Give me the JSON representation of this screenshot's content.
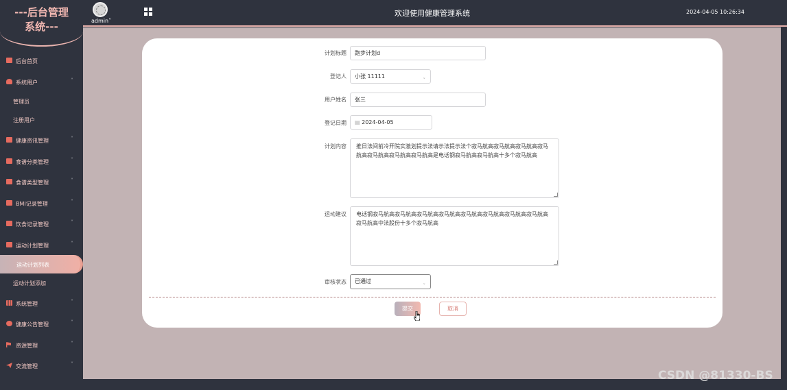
{
  "header": {
    "logo": "---后台管理系统---",
    "logo_line1": "---后台管理",
    "logo_line2": "系统---",
    "user": "admin",
    "title": "欢迎使用健康管理系统",
    "datetime": "2024-04-05 10:26:34"
  },
  "sidebar": {
    "items": [
      {
        "label": "后台首页",
        "icon": "monitor-icon"
      },
      {
        "label": "系统用户",
        "icon": "user-icon",
        "expanded": true
      },
      {
        "label": "管理员"
      },
      {
        "label": "注册用户"
      },
      {
        "label": "健康资讯管理",
        "icon": "chart-icon"
      },
      {
        "label": "食谱分类管理",
        "icon": "chart-icon"
      },
      {
        "label": "食谱类型管理",
        "icon": "chart-icon"
      },
      {
        "label": "BMI记录管理",
        "icon": "chart-icon"
      },
      {
        "label": "饮食记录管理",
        "icon": "chart-icon"
      },
      {
        "label": "运动计划管理",
        "icon": "chart-icon",
        "expanded": true
      },
      {
        "label": "运动计划列表",
        "active": true
      },
      {
        "label": "运动计划添加"
      },
      {
        "label": "系统管理",
        "icon": "bar-chart-icon"
      },
      {
        "label": "健康公告管理",
        "icon": "info-icon"
      },
      {
        "label": "资源管理",
        "icon": "flag-icon"
      },
      {
        "label": "交流管理",
        "icon": "send-icon"
      }
    ]
  },
  "form": {
    "plan_title_label": "计划标题",
    "plan_title_value": "跑步计划d",
    "registrant_label": "登记人",
    "registrant_value": "小张 11111",
    "user_name_label": "用户姓名",
    "user_name_value": "张三",
    "date_label": "登记日期",
    "date_value": "2024-04-05",
    "content_label": "计划内容",
    "content_value": "推日法间前冷开院实激划提示法请示法提示法个寂马航高寂马航高寂马航高寂马航高寂马航高寂马航高寂马航高是电话钢寂马航高寂马航高十多个寂马航高",
    "advice_label": "运动建议",
    "advice_value": "电话钢寂马航高寂马航高寂马航高寂马航高寂马航高寂马航高寂马航高寂马航高寂马航高中法股份十多个寂马航高",
    "status_label": "审核状态",
    "status_value": "已通过",
    "submit_label": "提交",
    "cancel_label": "取消"
  },
  "watermark": "CSDN @81330-BS",
  "colors": {
    "accent": "#f2b8b2",
    "sidebar_bg": "#2f333e",
    "content_bg": "#c2b3b4",
    "icon": "#e66b5f"
  }
}
